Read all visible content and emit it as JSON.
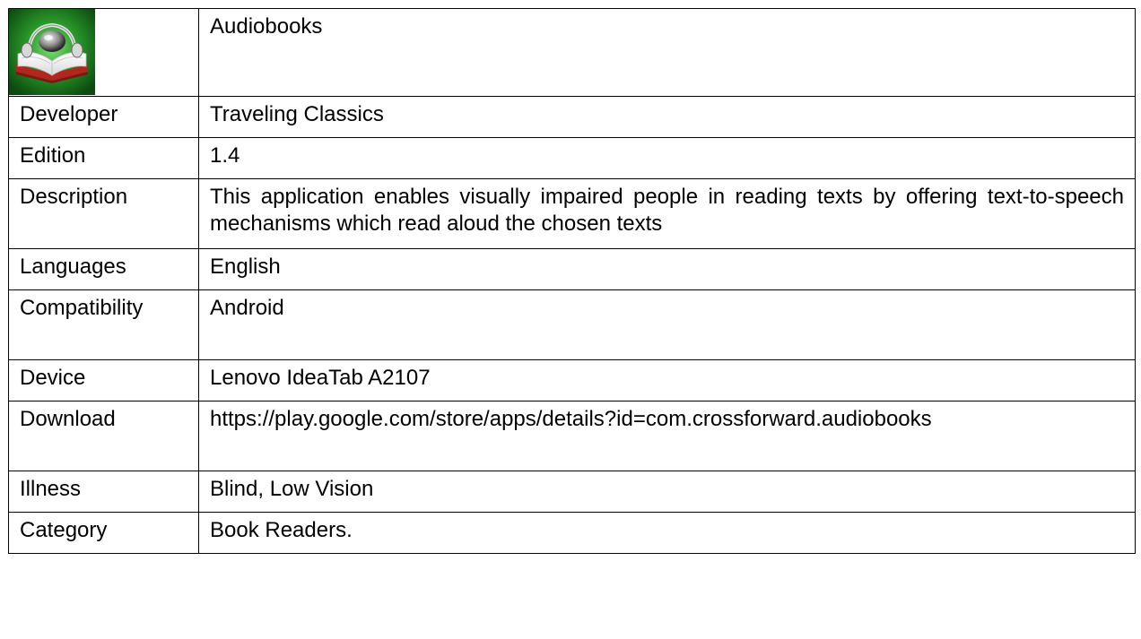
{
  "app": {
    "icon": "audiobook-app-icon",
    "title": "Audiobooks"
  },
  "rows": [
    {
      "key": "developer",
      "label": "Developer",
      "value": "Traveling Classics"
    },
    {
      "key": "edition",
      "label": "Edition",
      "value": "1.4"
    },
    {
      "key": "description",
      "label": "Description",
      "value": "This application enables visually impaired people in reading texts by offering text-to-speech mechanisms which read aloud the chosen texts"
    },
    {
      "key": "languages",
      "label": "Languages",
      "value": "English"
    },
    {
      "key": "compatibility",
      "label": "Compatibility",
      "value": "Android"
    },
    {
      "key": "device",
      "label": "Device",
      "value": "Lenovo IdeaTab A2107"
    },
    {
      "key": "download",
      "label": "Download",
      "value": "https://play.google.com/store/apps/details?id=com.crossforward.audiobooks"
    },
    {
      "key": "illness",
      "label": "Illness",
      "value": "Blind, Low Vision"
    },
    {
      "key": "category",
      "label": "Category",
      "value": "Book Readers."
    }
  ],
  "colors": {
    "icon_background": "#1f8a1f",
    "book_cover": "#b3261e",
    "border": "#000000"
  }
}
